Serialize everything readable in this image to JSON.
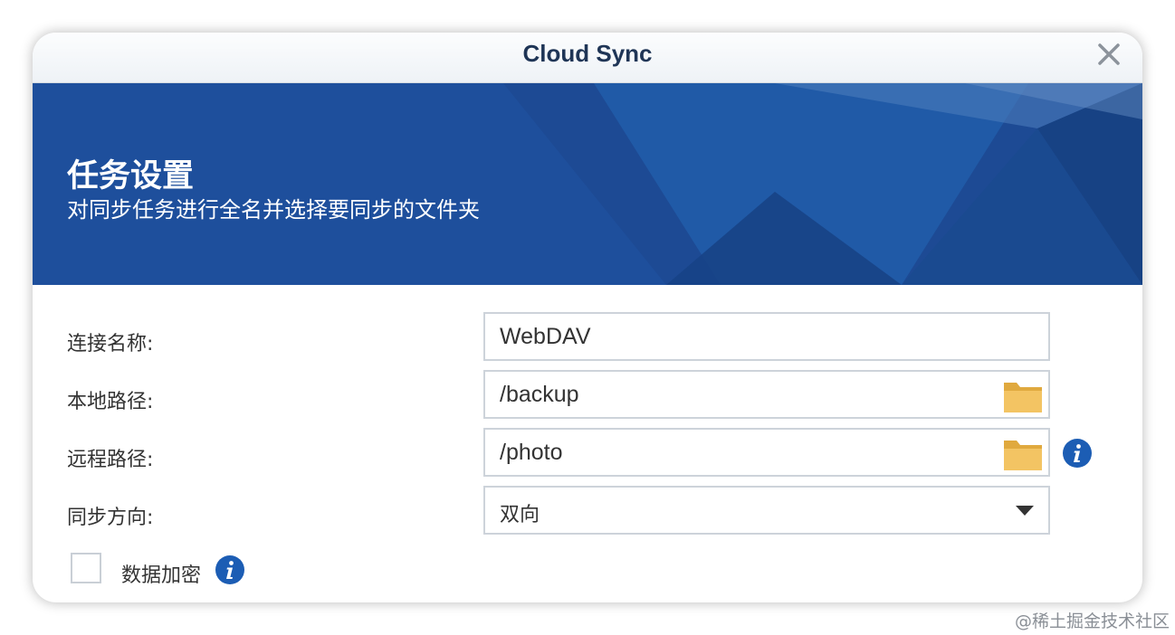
{
  "window": {
    "title": "Cloud Sync"
  },
  "banner": {
    "title": "任务设置",
    "subtitle": "对同步任务进行全名并选择要同步的文件夹"
  },
  "form": {
    "connection_name": {
      "label": "连接名称:",
      "value": "WebDAV"
    },
    "local_path": {
      "label": "本地路径:",
      "value": "/backup"
    },
    "remote_path": {
      "label": "远程路径:",
      "value": "/photo"
    },
    "sync_direction": {
      "label": "同步方向:",
      "value": "双向"
    },
    "encryption": {
      "label": "数据加密",
      "checked": false
    }
  },
  "icons": {
    "close": "close-icon",
    "folder": "folder-icon",
    "info": "info-icon",
    "dropdown": "chevron-down-icon"
  },
  "colors": {
    "banner": "#1e4f9c",
    "title_text": "#1f3556",
    "folder": "#f0c05a",
    "info": "#1c5db4"
  },
  "watermark": "@稀土掘金技术社区"
}
